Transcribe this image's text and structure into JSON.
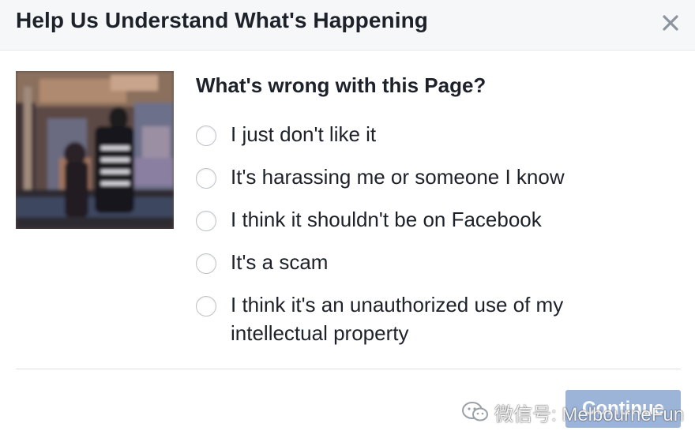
{
  "dialog": {
    "title": "Help Us Understand What's Happening",
    "close_icon": "close-icon",
    "question": "What's wrong with this Page?",
    "options": [
      {
        "label": "I just don't like it"
      },
      {
        "label": "It's harassing me or someone I know"
      },
      {
        "label": "I think it shouldn't be on Facebook"
      },
      {
        "label": "It's a scam"
      },
      {
        "label": "I think it's an unauthorized use of my intellectual property"
      }
    ],
    "continue_label": "Continue"
  },
  "watermark": {
    "text": "微信号: MelbourneFun",
    "icon": "wechat-icon"
  },
  "colors": {
    "header_bg": "#f6f7f9",
    "text": "#1d2129",
    "radio_border": "#bec3c9",
    "button_disabled_bg": "#9cb4d8",
    "divider": "#dddfe2"
  }
}
